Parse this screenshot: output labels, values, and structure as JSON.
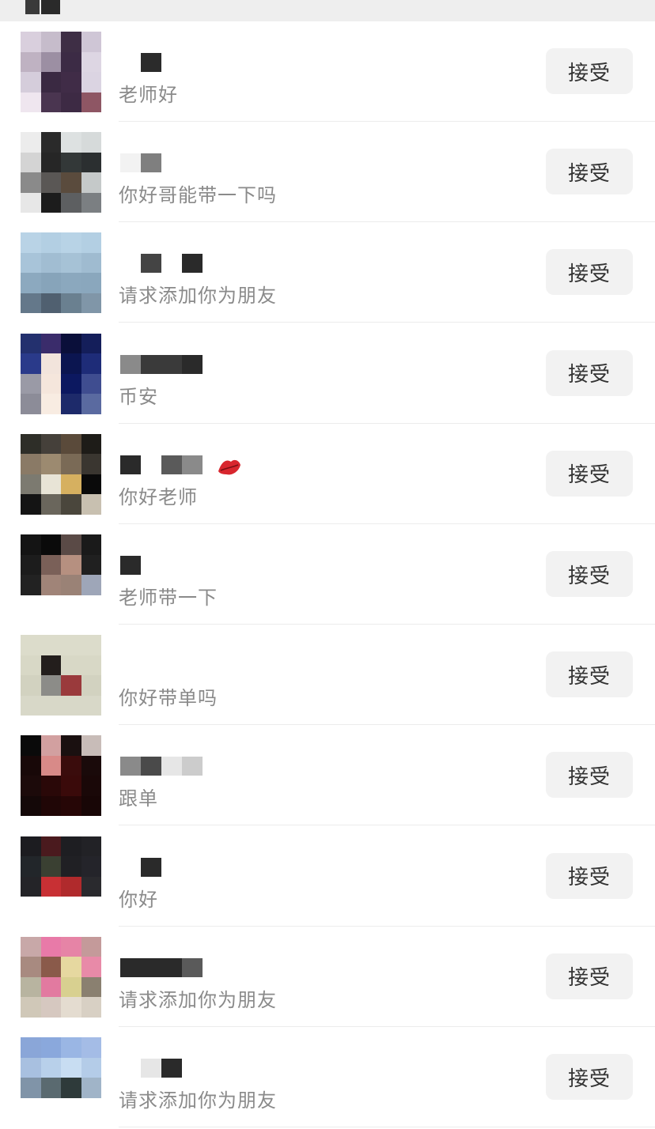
{
  "accept_label": "接受",
  "requests": [
    {
      "message": "老师好",
      "avatar_cols": 4,
      "avatar": [
        "#d9cfdd",
        "#c6bccb",
        "#3e2e45",
        "#cfc6d6",
        "#bfb2c2",
        "#9c8fa3",
        "#3c2b45",
        "#ddd6e3",
        "#d5cddb",
        "#3a2942",
        "#402c47",
        "#dbd4e2",
        "#efe6ef",
        "#4a3550",
        "#3d2a44",
        "#8e5664"
      ],
      "name_blocks": [
        [
          "#ffffff",
          0,
          26
        ],
        [
          "#2b2b2b",
          26,
          26
        ],
        [
          "#ffffff",
          52,
          10
        ]
      ]
    },
    {
      "message": "你好哥能带一下吗",
      "avatar_cols": 4,
      "avatar": [
        "#ececec",
        "#2a2a2a",
        "#dde1e1",
        "#d6dada",
        "#d4d4d4",
        "#262626",
        "#333838",
        "#2b2f30",
        "#8a8a8a",
        "#5a5755",
        "#5a4b3d",
        "#c5c9c9",
        "#e7e7e7",
        "#1c1c1c",
        "#5d5f61",
        "#7b7f82"
      ],
      "name_blocks": [
        [
          "#f2f2f2",
          0,
          26
        ],
        [
          "#7f7f7f",
          26,
          26
        ]
      ]
    },
    {
      "message": "请求添加你为朋友",
      "avatar_cols": 4,
      "avatar": [
        "#b9d3e6",
        "#b3cfe3",
        "#b8d3e6",
        "#b3cfe3",
        "#a8c4d9",
        "#a1bdd2",
        "#a6c2d6",
        "#9fbbd0",
        "#8ca9bf",
        "#87a4ba",
        "#8ba8be",
        "#8aa7bd",
        "#64788a",
        "#506070",
        "#6a8090",
        "#8096a8"
      ],
      "name_blocks": [
        [
          "#ffffff",
          0,
          26
        ],
        [
          "#444444",
          26,
          26
        ],
        [
          "#ffffff",
          52,
          26
        ],
        [
          "#2a2a2a",
          78,
          26
        ]
      ]
    },
    {
      "message": "币安",
      "avatar_cols": 4,
      "avatar": [
        "#23306e",
        "#3a2c6b",
        "#0a0f3a",
        "#141e5a",
        "#2a3a8a",
        "#f2e4dc",
        "#0b1550",
        "#1e2c78",
        "#9a9aa6",
        "#f5e6dc",
        "#0c1860",
        "#3f4d90",
        "#8c8c98",
        "#f8ece2",
        "#1d2a6a",
        "#5a6aa0"
      ],
      "name_blocks": [
        [
          "#8a8a8a",
          0,
          26
        ],
        [
          "#3a3a3a",
          26,
          26
        ],
        [
          "#3a3a3a",
          52,
          26
        ],
        [
          "#2a2a2a",
          78,
          26
        ]
      ]
    },
    {
      "message": "你好老师",
      "avatar_cols": 4,
      "avatar": [
        "#2e2e28",
        "#45403a",
        "#5a4a3a",
        "#1e1c18",
        "#8a7a66",
        "#9c8a70",
        "#7a6a56",
        "#3a3630",
        "#7c7a70",
        "#e8e4d6",
        "#d6b060",
        "#0a0a0a",
        "#141414",
        "#6a665c",
        "#4a463c",
        "#c8c0b0"
      ],
      "name_blocks": [
        [
          "#2a2a2a",
          0,
          26
        ],
        [
          "#ffffff",
          26,
          26
        ],
        [
          "#5a5a5a",
          52,
          26
        ],
        [
          "#8a8a8a",
          78,
          26
        ]
      ]
    },
    {
      "message": "老师带一下",
      "avatar_cols": 4,
      "avatar": [
        "#141414",
        "#0a0a0a",
        "#5a4a46",
        "#1a1a1a",
        "#1c1c1c",
        "#7a6058",
        "#b69080",
        "#202020",
        "#222222",
        "#a08478",
        "#9a8276",
        "#9ea6b8",
        "#ffffff",
        "#ffffff",
        "#ffffff",
        "#ffffff"
      ],
      "name_blocks": [
        [
          "#2a2a2a",
          0,
          26
        ],
        [
          "#ffffff",
          26,
          26
        ]
      ]
    },
    {
      "message": "你好带单吗",
      "avatar_cols": 4,
      "avatar": [
        "#dcdccb",
        "#dcdccb",
        "#dcdccb",
        "#dcdccb",
        "#d8d8c6",
        "#231e1c",
        "#d8d8c6",
        "#d8d8c6",
        "#d2d2c0",
        "#8c8c88",
        "#9a3a3c",
        "#d2d2c0",
        "#d8d8c8",
        "#d8d8c8",
        "#d8d8c8",
        "#d8d8c8"
      ],
      "name_blocks": [
        [
          "#ffffff",
          0,
          26
        ],
        [
          "#ffffff",
          26,
          26
        ]
      ]
    },
    {
      "message": "跟单",
      "avatar_cols": 4,
      "avatar": [
        "#0a0a0a",
        "#d2a0a0",
        "#1a1010",
        "#c8bcb8",
        "#180808",
        "#d88a88",
        "#3a0c0c",
        "#1a0a0a",
        "#1c0a0a",
        "#2a0808",
        "#3a0a0a",
        "#1a0808",
        "#140808",
        "#200606",
        "#260606",
        "#180606"
      ],
      "name_blocks": [
        [
          "#8a8a8a",
          0,
          26
        ],
        [
          "#4a4a4a",
          26,
          26
        ],
        [
          "#e6e6e6",
          52,
          26
        ],
        [
          "#cccccc",
          78,
          26
        ]
      ]
    },
    {
      "message": "你好",
      "avatar_cols": 4,
      "avatar": [
        "#1c1c20",
        "#4a1a1e",
        "#1e1e22",
        "#222226",
        "#22262a",
        "#3a4032",
        "#202024",
        "#24242a",
        "#242428",
        "#c83034",
        "#b02a2c",
        "#2a2a2e",
        "#ffffff",
        "#ffffff",
        "#ffffff",
        "#ffffff"
      ],
      "name_blocks": [
        [
          "#ffffff",
          0,
          26
        ],
        [
          "#2a2a2a",
          26,
          26
        ]
      ]
    },
    {
      "message": "请求添加你为朋友",
      "avatar_cols": 4,
      "avatar": [
        "#c8a8a8",
        "#e87aa8",
        "#e684a6",
        "#c49a9a",
        "#a88a80",
        "#8a5a4a",
        "#e6d8a0",
        "#e88aa8",
        "#b8b4a0",
        "#e27aa0",
        "#d8d090",
        "#8a8070",
        "#d0c8b8",
        "#d6c8c0",
        "#e4dcd0",
        "#d8d0c4"
      ],
      "name_blocks": [
        [
          "#2a2a2a",
          0,
          26
        ],
        [
          "#2a2a2a",
          26,
          26
        ],
        [
          "#2a2a2a",
          52,
          26
        ],
        [
          "#5a5a5a",
          78,
          26
        ]
      ]
    },
    {
      "message": "请求添加你为朋友",
      "avatar_cols": 4,
      "avatar": [
        "#8aa6d8",
        "#8aa8dc",
        "#9ab6e4",
        "#a4bce6",
        "#a8c0e0",
        "#b8d0ea",
        "#c8ddf2",
        "#b4cce8",
        "#8094a8",
        "#5a6a70",
        "#2e3a3a",
        "#a0b4c8",
        "#ffffff",
        "#ffffff",
        "#ffffff",
        "#ffffff"
      ],
      "name_blocks": [
        [
          "#ffffff",
          0,
          26
        ],
        [
          "#e6e6e6",
          26,
          26
        ],
        [
          "#2a2a2a",
          52,
          26
        ]
      ]
    }
  ]
}
